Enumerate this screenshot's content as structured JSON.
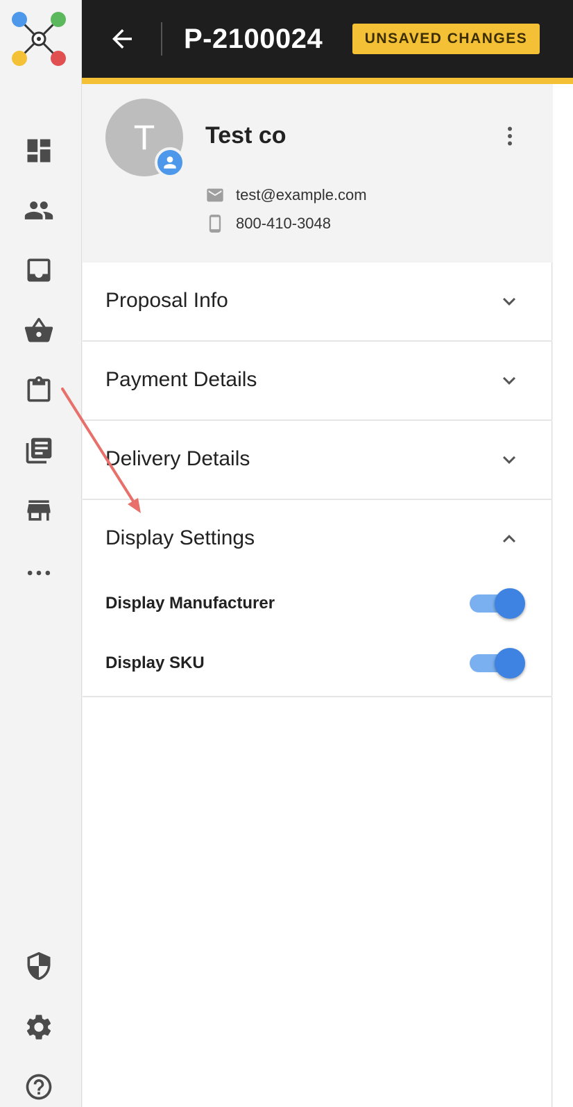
{
  "header": {
    "document_id": "P-2100024",
    "status_badge": "UNSAVED CHANGES",
    "accent_color": "#f4c136",
    "background_color": "#1e1e1e"
  },
  "sidebar": {
    "logo": "app-logo",
    "items": [
      {
        "icon": "dashboard-icon"
      },
      {
        "icon": "people-icon"
      },
      {
        "icon": "inbox-icon"
      },
      {
        "icon": "basket-icon"
      },
      {
        "icon": "clipboard-icon"
      },
      {
        "icon": "library-icon"
      },
      {
        "icon": "store-icon"
      },
      {
        "icon": "more-horizontal-icon"
      }
    ],
    "bottom_items": [
      {
        "icon": "shield-icon"
      },
      {
        "icon": "gear-icon"
      },
      {
        "icon": "help-icon"
      }
    ]
  },
  "contact": {
    "avatar_initial": "T",
    "company_name": "Test co",
    "email": "test@example.com",
    "phone": "800-410-3048"
  },
  "sections": [
    {
      "title": "Proposal Info",
      "expanded": false
    },
    {
      "title": "Payment Details",
      "expanded": false
    },
    {
      "title": "Delivery Details",
      "expanded": false
    },
    {
      "title": "Display Settings",
      "expanded": true
    }
  ],
  "display_settings": [
    {
      "label": "Display Manufacturer",
      "enabled": true
    },
    {
      "label": "Display SKU",
      "enabled": true
    }
  ],
  "colors": {
    "toggle_on": "#3e82e2",
    "annotation_arrow": "#e8706a"
  }
}
